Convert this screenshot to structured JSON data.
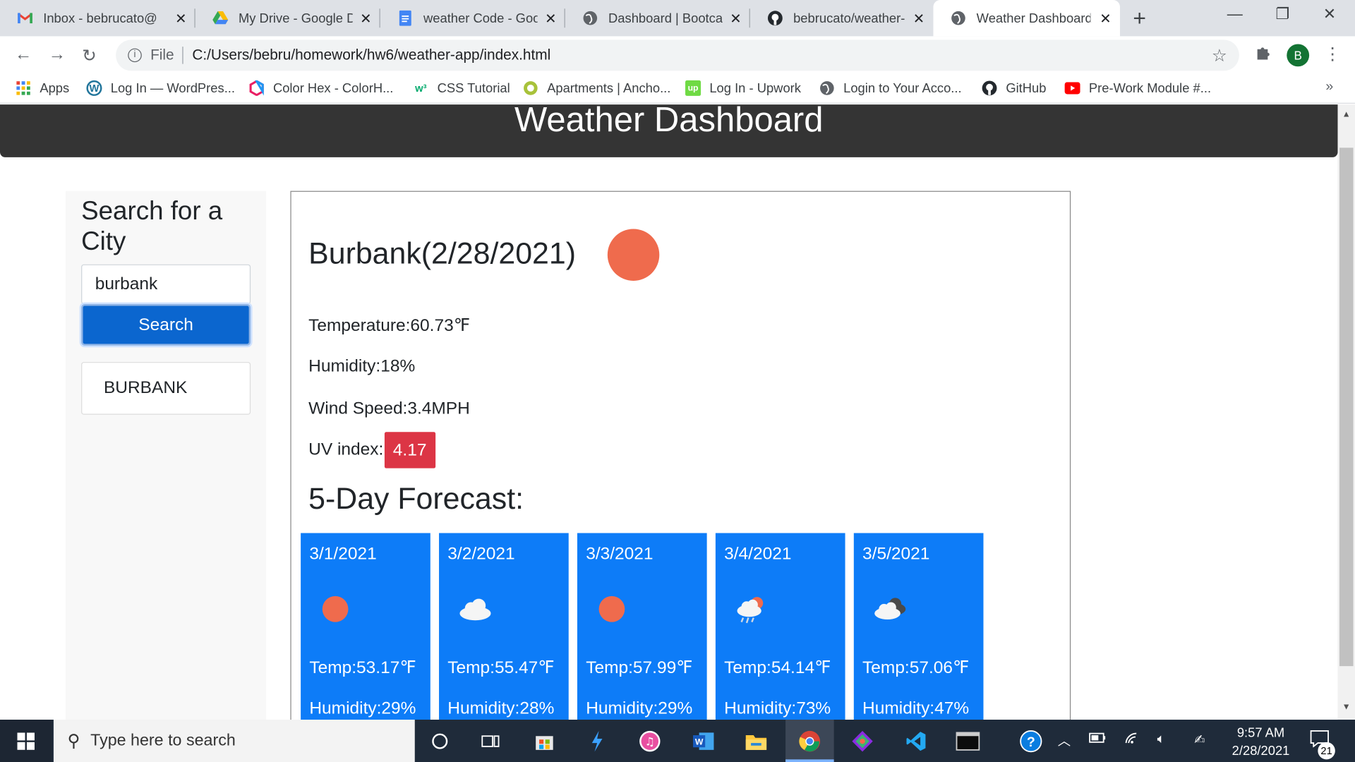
{
  "browser": {
    "tabs": [
      {
        "title": "Inbox - bebrucato@",
        "icon": "gmail-icon"
      },
      {
        "title": "My Drive - Google D",
        "icon": "google-drive-icon"
      },
      {
        "title": "weather Code - Goo",
        "icon": "google-docs-icon"
      },
      {
        "title": "Dashboard | Bootcan",
        "icon": "globe-icon"
      },
      {
        "title": "bebrucato/weather-",
        "icon": "github-icon"
      },
      {
        "title": "Weather Dashboard",
        "icon": "globe-icon",
        "active": true
      }
    ],
    "address": {
      "scheme": "File",
      "path": "C:/Users/bebru/homework/hw6/weather-app/index.html"
    },
    "profile_initial": "B",
    "bookmarks": [
      {
        "label": "Apps",
        "icon": "apps-grid-icon"
      },
      {
        "label": "Log In — WordPres...",
        "icon": "wordpress-icon"
      },
      {
        "label": "Color Hex - ColorH...",
        "icon": "colorhex-icon"
      },
      {
        "label": "CSS Tutorial",
        "icon": "w3schools-icon"
      },
      {
        "label": "Apartments | Ancho...",
        "icon": "apartments-icon"
      },
      {
        "label": "Log In - Upwork",
        "icon": "upwork-icon"
      },
      {
        "label": "Login to Your Acco...",
        "icon": "globe-icon"
      },
      {
        "label": "GitHub",
        "icon": "github-icon"
      },
      {
        "label": "Pre-Work Module #...",
        "icon": "youtube-icon"
      }
    ]
  },
  "page": {
    "header_title": "Weather Dashboard",
    "sidebar": {
      "heading": "Search for a City",
      "search_value": "burbank",
      "search_button": "Search",
      "history": [
        "BURBANK"
      ]
    },
    "current": {
      "title": "Burbank(2/28/2021)",
      "icon": "sun-icon",
      "temperature": "Temperature:60.73℉",
      "humidity": "Humidity:18%",
      "wind": "Wind Speed:3.4MPH",
      "uv_label": "UV index:",
      "uv_value": "4.17",
      "uv_color": "#dc3545"
    },
    "forecast_title": "5-Day Forecast:",
    "forecast": [
      {
        "date": "3/1/2021",
        "icon": "sun-icon",
        "temp": "Temp:53.17℉",
        "humidity": "Humidity:29%"
      },
      {
        "date": "3/2/2021",
        "icon": "cloud-icon",
        "temp": "Temp:55.47℉",
        "humidity": "Humidity:28%"
      },
      {
        "date": "3/3/2021",
        "icon": "sun-icon",
        "temp": "Temp:57.99℉",
        "humidity": "Humidity:29%"
      },
      {
        "date": "3/4/2021",
        "icon": "rain-sun-cloud-icon",
        "temp": "Temp:54.14℉",
        "humidity": "Humidity:73%"
      },
      {
        "date": "3/5/2021",
        "icon": "dark-clouds-icon",
        "temp": "Temp:57.06℉",
        "humidity": "Humidity:47%"
      }
    ],
    "card_color": "#0d7cf8",
    "sun_color": "#ef6b4d"
  },
  "taskbar": {
    "search_placeholder": "Type here to search",
    "time": "9:57 AM",
    "date": "2/28/2021",
    "notification_count": "21"
  }
}
